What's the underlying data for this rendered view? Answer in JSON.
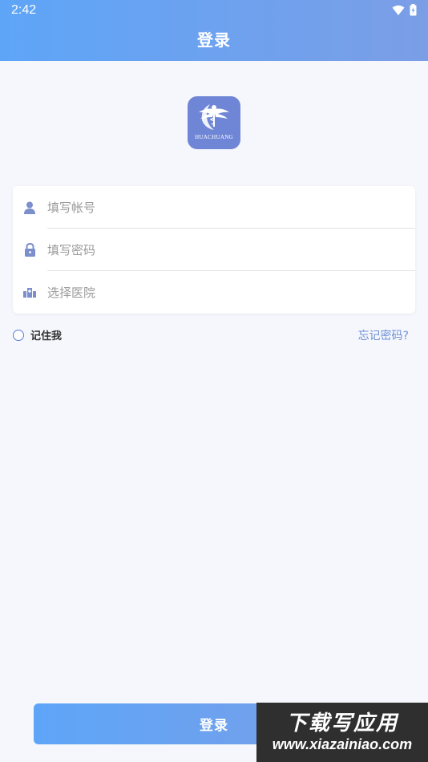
{
  "status_bar": {
    "time": "2:42"
  },
  "header": {
    "title": "登录"
  },
  "logo": {
    "text": "HUACHUANG",
    "subtext": ""
  },
  "form": {
    "account_placeholder": "填写帐号",
    "password_placeholder": "填写密码",
    "hospital_placeholder": "选择医院"
  },
  "remember": {
    "label": "记住我",
    "checked": false
  },
  "forgot_password": "忘记密码?",
  "login_button": "登录",
  "watermark": {
    "main": "下载写应用",
    "sub": "www.xiazainiao.com"
  },
  "colors": {
    "accent": "#6d8fd9",
    "gradient_start": "#5ea5f8",
    "gradient_end": "#7b9ee6"
  }
}
